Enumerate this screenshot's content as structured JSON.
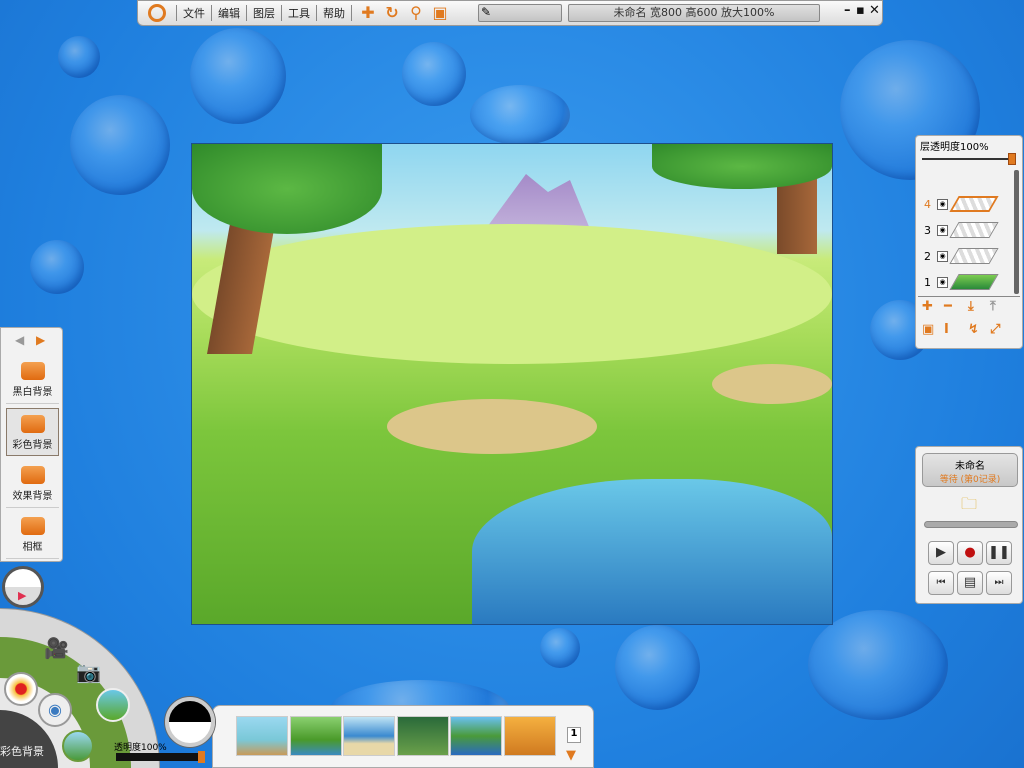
{
  "toolbar": {
    "menus": [
      "文件",
      "编辑",
      "图层",
      "工具",
      "帮助"
    ],
    "status": "未命名  宽800  高600  放大100%",
    "minimize": "–",
    "maximize": "▪",
    "close": "✕"
  },
  "layers": {
    "opacity_label": "层透明度100%",
    "opacity": 100,
    "items": [
      {
        "num": "4",
        "active": true
      },
      {
        "num": "3"
      },
      {
        "num": "2"
      },
      {
        "num": "1"
      }
    ]
  },
  "recorder": {
    "name": "未命名",
    "status": "等待 (第0记录)"
  },
  "backgrounds": {
    "items": [
      "黑白背景",
      "彩色背景",
      "效果背景",
      "相框"
    ],
    "selected": "彩色背景"
  },
  "wheel": {
    "label": "彩色背景"
  },
  "bottom": {
    "opacity_label": "透明度100%",
    "page": "1"
  },
  "colors": {
    "accent": "#e07a20",
    "bg": "#1f7fde"
  }
}
